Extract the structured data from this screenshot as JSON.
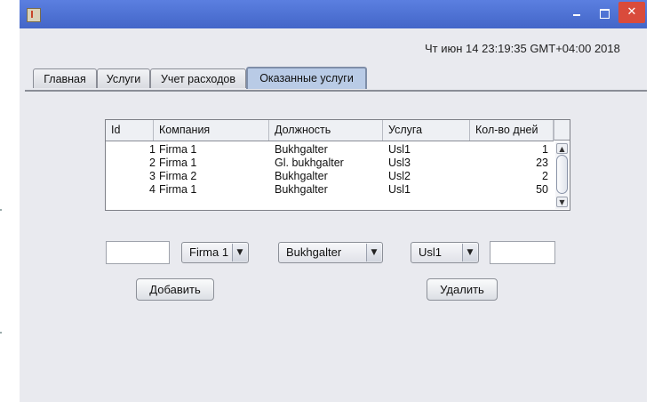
{
  "window": {
    "title": "",
    "controls": {
      "minimize": "–",
      "maximize": "□",
      "close": "✕"
    }
  },
  "clock": "Чт июн 14 23:19:35 GMT+04:00 2018",
  "tabs": [
    {
      "label": "Главная"
    },
    {
      "label": "Услуги"
    },
    {
      "label": "Учет расходов"
    },
    {
      "label": "Оказанные услуги"
    }
  ],
  "table": {
    "columns": [
      "Id",
      "Компания",
      "Должность",
      "Услуга",
      "Кол-во дней"
    ],
    "rows": [
      {
        "id": "1",
        "company": "Firma 1",
        "position": "Bukhgalter",
        "service": "Usl1",
        "days": "1"
      },
      {
        "id": "2",
        "company": "Firma 1",
        "position": "Gl. bukhgalter",
        "service": "Usl3",
        "days": "23"
      },
      {
        "id": "3",
        "company": "Firma 2",
        "position": "Bukhgalter",
        "service": "Usl2",
        "days": "2"
      },
      {
        "id": "4",
        "company": "Firma 1",
        "position": "Bukhgalter",
        "service": "Usl1",
        "days": "50"
      }
    ]
  },
  "form": {
    "id_value": "",
    "company_selected": "Firma 1",
    "position_selected": "Bukhgalter",
    "service_selected": "Usl1",
    "days_value": "",
    "add_label": "Добавить",
    "delete_label": "Удалить"
  }
}
